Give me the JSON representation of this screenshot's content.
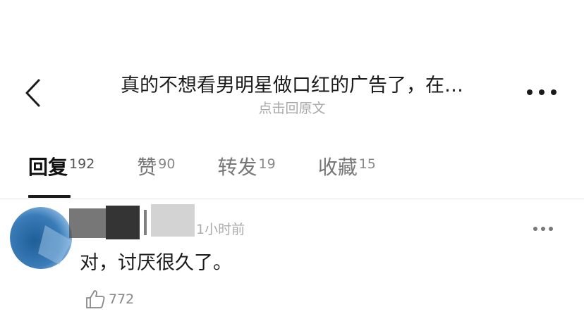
{
  "header": {
    "title": "真的不想看男明星做口红的广告了，在…",
    "subtitle": "点击回原文",
    "back_icon": "chevron-left-icon",
    "more_icon": "more-horizontal-icon"
  },
  "tabs": [
    {
      "label": "回复",
      "count": "192",
      "active": true
    },
    {
      "label": "赞",
      "count": "90",
      "active": false
    },
    {
      "label": "转发",
      "count": "19",
      "active": false
    },
    {
      "label": "收藏",
      "count": "15",
      "active": false
    }
  ],
  "comment": {
    "time": "1小时前",
    "text": "对，讨厌很久了。",
    "likes": "772",
    "like_icon": "thumbs-up-icon",
    "more_icon": "more-horizontal-icon"
  },
  "colors": {
    "avatar_blue": "#2f6ea8",
    "text_primary": "#1a1a1a",
    "text_secondary": "#aaaaaa"
  }
}
